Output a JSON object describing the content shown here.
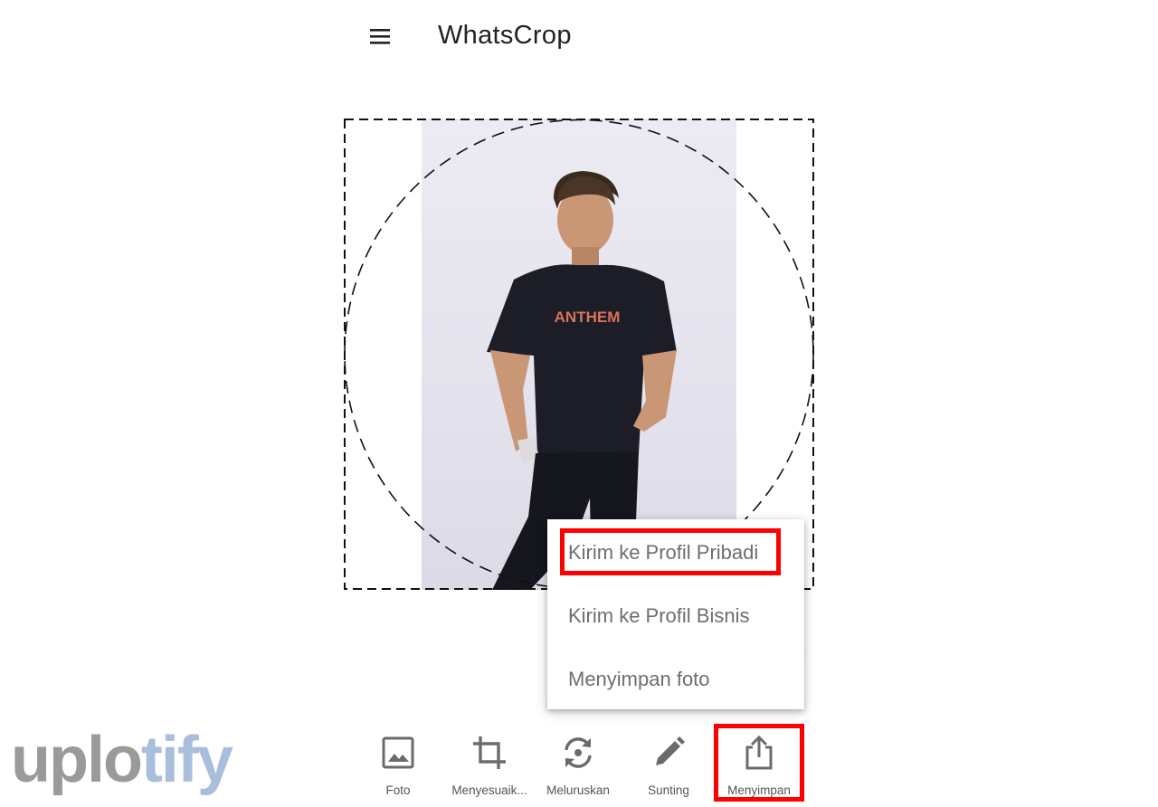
{
  "app_bar": {
    "title": "WhatsCrop",
    "menu_icon": "hamburger-menu-icon"
  },
  "canvas": {
    "crop_shape": "circle",
    "photo_subject": "man in black t-shirt",
    "shirt_print": "ANTHEM"
  },
  "popup_menu": {
    "items": [
      {
        "label": "Kirim ke Profil Pribadi",
        "highlighted": true
      },
      {
        "label": "Kirim ke Profil Bisnis",
        "highlighted": false
      },
      {
        "label": "Menyimpan foto",
        "highlighted": false
      }
    ]
  },
  "toolbar": {
    "items": [
      {
        "label": "Foto",
        "icon": "image-icon"
      },
      {
        "label": "Menyesuaik...",
        "icon": "crop-icon"
      },
      {
        "label": "Meluruskan",
        "icon": "rotate-icon"
      },
      {
        "label": "Sunting",
        "icon": "pencil-icon"
      },
      {
        "label": "Menyimpan",
        "icon": "share-icon",
        "highlighted": true
      }
    ]
  },
  "watermark": {
    "text_dark": "uplo",
    "text_light": "tify"
  },
  "colors": {
    "highlight": "#ff0000",
    "icon": "#6b6b6b",
    "menu_text": "#6e6e6e",
    "watermark_dark": "#9a9a9a",
    "watermark_light": "#a9bedc",
    "chevron": "#2aa7b0"
  }
}
